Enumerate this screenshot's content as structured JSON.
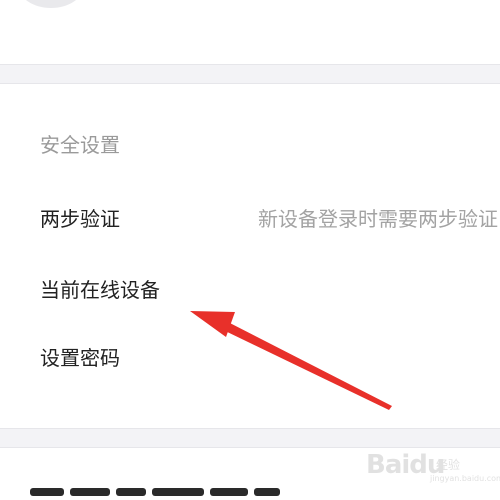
{
  "security": {
    "heading": "安全设置",
    "items": [
      {
        "label": "两步验证",
        "description": "新设备登录时需要两步验证"
      },
      {
        "label": "当前在线设备"
      },
      {
        "label": "设置密码"
      }
    ]
  },
  "watermark": {
    "brand": "Baidu",
    "sub": "经验",
    "url": "jingyan.baidu.com"
  },
  "colors": {
    "heading": "#9a9a9a",
    "label": "#222222",
    "description": "#a3a3a3",
    "band": "#f3f3f6",
    "arrow": "#e8302a"
  }
}
